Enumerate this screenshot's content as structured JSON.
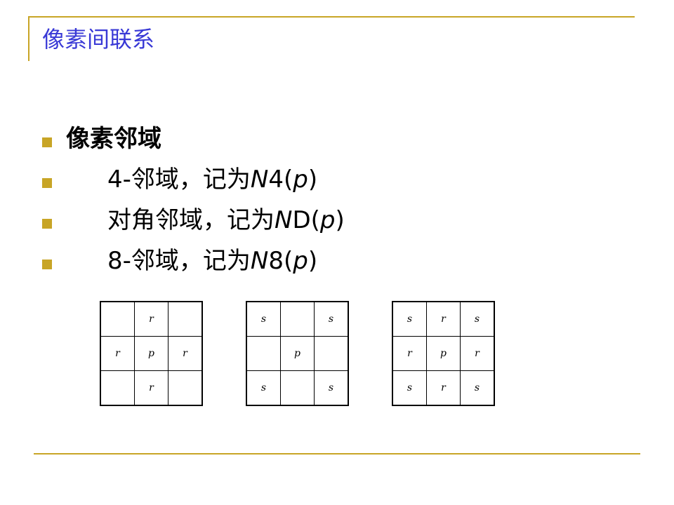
{
  "slide": {
    "title": "像素间联系",
    "accent_color": "#c8a526",
    "title_color": "#3939d6"
  },
  "bullets": [
    {
      "text": "像素邻域",
      "heading": true
    },
    {
      "prefix": "4-邻域，记为",
      "sym_italic": "N",
      "sym_plain": "4(",
      "arg": "p",
      "close": ")"
    },
    {
      "prefix": "对角邻域，记为",
      "sym_italic": "N",
      "sym_plain": "D(",
      "arg": "p",
      "close": ")"
    },
    {
      "prefix": "8-邻域，记为",
      "sym_italic": "N",
      "sym_plain": "8(",
      "arg": "p",
      "close": ")"
    }
  ],
  "grids": [
    {
      "rows": [
        [
          "",
          "r",
          ""
        ],
        [
          "r",
          "p",
          "r"
        ],
        [
          "",
          "r",
          ""
        ]
      ]
    },
    {
      "rows": [
        [
          "s",
          "",
          "s"
        ],
        [
          "",
          "p",
          ""
        ],
        [
          "s",
          "",
          "s"
        ]
      ]
    },
    {
      "rows": [
        [
          "s",
          "r",
          "s"
        ],
        [
          "r",
          "p",
          "r"
        ],
        [
          "s",
          "r",
          "s"
        ]
      ]
    }
  ]
}
